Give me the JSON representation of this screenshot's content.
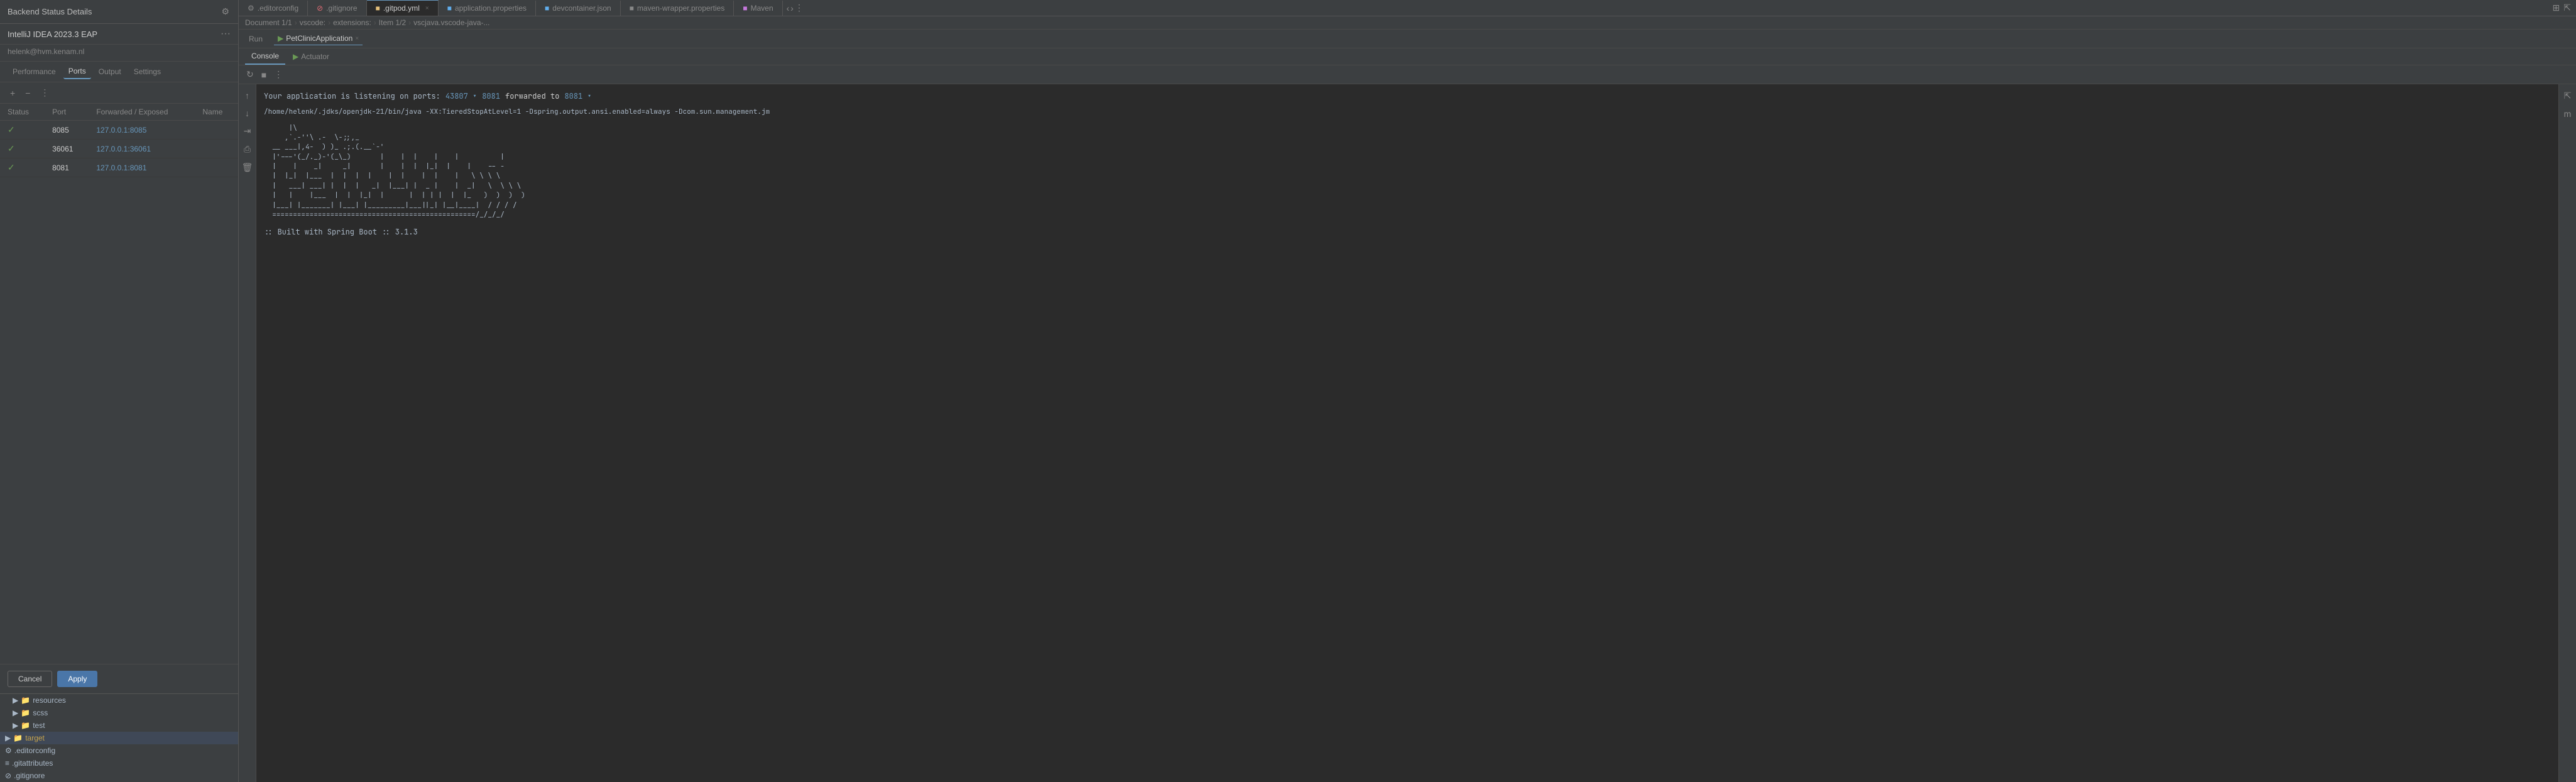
{
  "leftPanel": {
    "title": "Backend Status Details",
    "ideaName": "IntelliJ IDEA 2023.3 EAP",
    "userEmail": "helenk@hvm.kenam.nl",
    "tabs": [
      {
        "id": "performance",
        "label": "Performance",
        "active": false
      },
      {
        "id": "ports",
        "label": "Ports",
        "active": true
      },
      {
        "id": "output",
        "label": "Output",
        "active": false
      },
      {
        "id": "settings",
        "label": "Settings",
        "active": false
      }
    ],
    "portsTable": {
      "headers": [
        "Status",
        "Port",
        "Forwarded / Exposed",
        "Name"
      ],
      "rows": [
        {
          "status": "✓",
          "port": "8085",
          "forwarded": "127.0.0.1:8085",
          "name": ""
        },
        {
          "status": "✓",
          "port": "36061",
          "forwarded": "127.0.0.1:36061",
          "name": ""
        },
        {
          "status": "✓",
          "port": "8081",
          "forwarded": "127.0.0.1:8081",
          "name": ""
        }
      ]
    },
    "actions": {
      "cancelLabel": "Cancel",
      "applyLabel": "Apply"
    },
    "fileTree": [
      {
        "type": "folder",
        "label": "resources",
        "indent": 1,
        "expanded": false
      },
      {
        "type": "folder",
        "label": "scss",
        "indent": 1,
        "expanded": false
      },
      {
        "type": "folder",
        "label": "test",
        "indent": 1,
        "expanded": false
      },
      {
        "type": "folder",
        "label": "target",
        "indent": 0,
        "expanded": false,
        "selected": true
      },
      {
        "type": "file",
        "label": ".editorconfig",
        "indent": 0
      },
      {
        "type": "file",
        "label": ".gitattributes",
        "indent": 0
      },
      {
        "type": "file",
        "label": ".gitignore",
        "indent": 0
      }
    ]
  },
  "rightPanel": {
    "fileTabs": [
      {
        "id": "editorconfig",
        "label": ".editorconfig",
        "icon": "gear",
        "color": "#888",
        "active": false,
        "closable": false
      },
      {
        "id": "gitignore",
        "label": ".gitignore",
        "icon": "circle",
        "color": "#e06c75",
        "active": false,
        "closable": false
      },
      {
        "id": "gitpod",
        "label": ".gitpod.yml",
        "icon": "circle",
        "color": "#e5c07b",
        "active": true,
        "closable": true
      },
      {
        "id": "application",
        "label": "application.properties",
        "icon": "circle",
        "color": "#61afef",
        "active": false,
        "closable": false
      },
      {
        "id": "devcontainer",
        "label": "devcontainer.json",
        "icon": "circle",
        "color": "#61afef",
        "active": false,
        "closable": false
      },
      {
        "id": "maven-wrapper",
        "label": "maven-wrapper.properties",
        "icon": "circle",
        "color": "#888",
        "active": false,
        "closable": false
      },
      {
        "id": "maven",
        "label": "Maven",
        "icon": "circle",
        "color": "#c678dd",
        "active": false,
        "closable": false
      }
    ],
    "breadcrumb": {
      "document": "Document 1/1",
      "path": [
        {
          "label": "vscode:"
        },
        {
          "label": "extensions:"
        },
        {
          "label": "Item 1/2"
        },
        {
          "label": "vscjava.vscode-java-..."
        }
      ]
    },
    "runBar": {
      "runLabel": "Run",
      "activeTab": "PetClinicApplication",
      "closeSymbol": "×"
    },
    "consoleTabs": [
      {
        "id": "console",
        "label": "Console",
        "active": true
      },
      {
        "id": "actuator",
        "label": "Actuator",
        "active": false,
        "icon": "▶"
      }
    ],
    "portBanner": {
      "text": "Your application is listening on ports:",
      "port1": "43807",
      "arrow": "▾",
      "port2": "8081",
      "forwardedText": "forwarded to",
      "port3": "8081",
      "port3Arrow": "▾"
    },
    "commandLine": "/home/helenk/.jdks/openjdk-21/bin/java  -XX:TieredStopAtLevel=1 -Dspring.output.ansi.enabled=always  -Dcom.sun.management.jm",
    "asciiArt": "      |\\\n     ,`.-''\\ .-  \\-;;,_\n  __ ___|,4-  ) )_ .;.(.__'-'\n  |'---'(_/.-)-(\\_.)\n  |    |    _|     |    |  |    |    |          |\n  |  _ |   ___|-   _|      |    |  |  |_|  |    |  -- -\n  | |_|  |___  |  |  |  |    |  |    |  |    |  \\ \\ \\ \\\n  |   ___| ___| |  |  |   _|  |___| |  _ |    |  |  _| \\  \\ \\ \\\n  |   |    |___  |  |  |_|  |      |  | | |  |  |  |_   )  )  )  )\n  |___| |_______| |___| |_________|___||_| |__|____|  / / / /\n  =================================================/_/_/_/",
    "springBootLine": ":: Built with Spring Boot :: 3.1.3"
  }
}
